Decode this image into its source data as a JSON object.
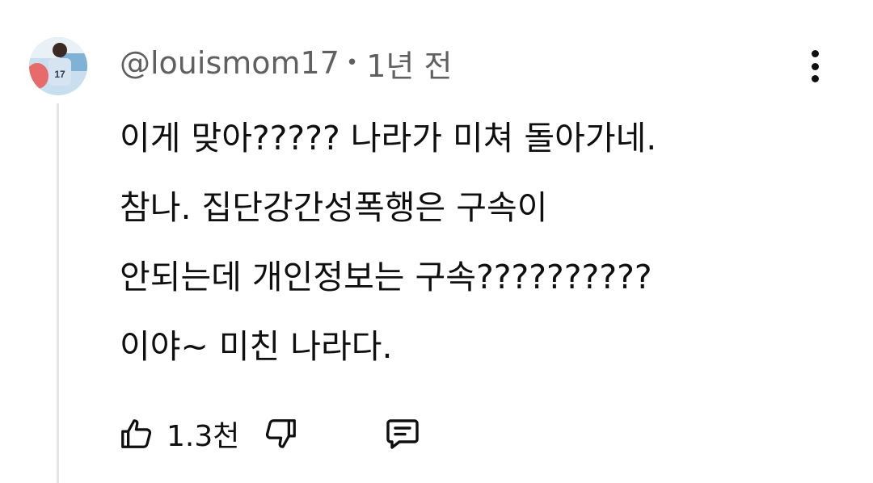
{
  "comment": {
    "author": "@louismom17",
    "separator": "•",
    "time": "1년 전",
    "avatar_jersey_number": "17",
    "text_lines": [
      "이게 맞아????? 나라가 미쳐 돌아가네.",
      "참나. 집단강간성폭행은 구속이",
      "안되는데 개인정보는 구속??????????",
      "이야~ 미친 나라다."
    ],
    "likes": "1.3천"
  },
  "icons": {
    "like": "thumbs-up-icon",
    "dislike": "thumbs-down-icon",
    "reply": "comment-icon",
    "menu": "more-vert-icon"
  },
  "colors": {
    "text": "#0f0f0f",
    "secondary": "#606060",
    "thread_line": "#e5e5e5"
  }
}
